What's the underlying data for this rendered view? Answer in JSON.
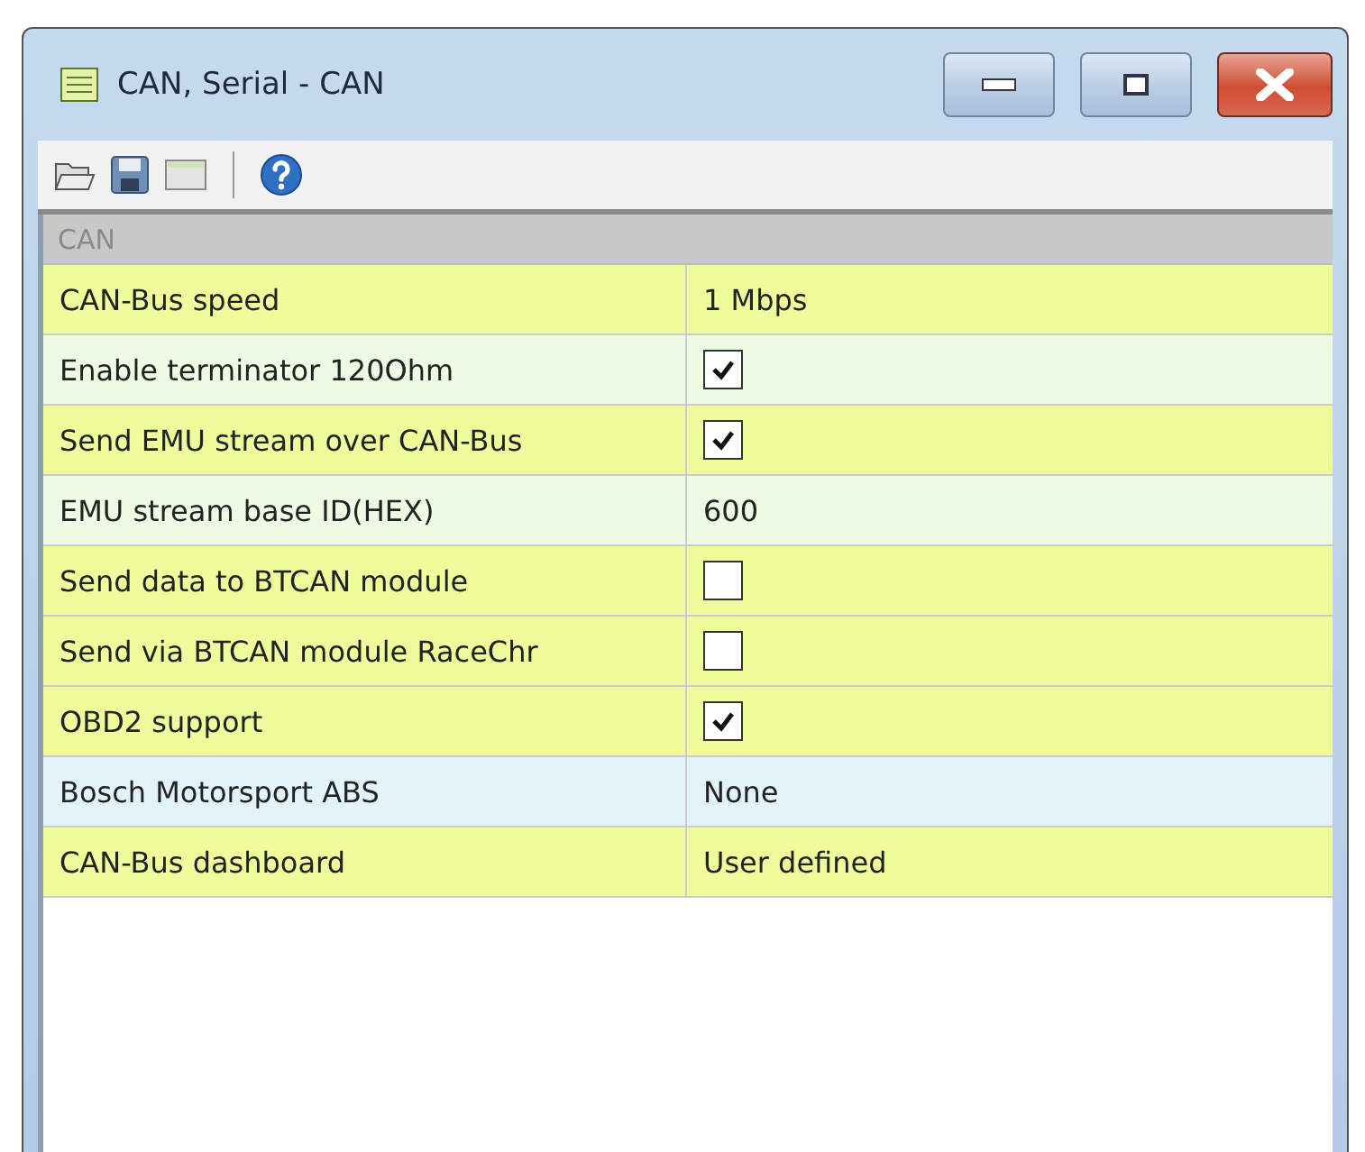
{
  "window": {
    "title": "CAN, Serial - CAN"
  },
  "group": {
    "label": "CAN"
  },
  "rows": [
    {
      "label": "CAN-Bus speed",
      "kind": "text",
      "value": "1 Mbps",
      "color": "#eefc9c"
    },
    {
      "label": "Enable terminator 120Ohm",
      "kind": "checkbox",
      "checked": true,
      "color": "#eefbe4"
    },
    {
      "label": "Send EMU stream over CAN-Bus",
      "kind": "checkbox",
      "checked": true,
      "color": "#eefc9c"
    },
    {
      "label": "EMU stream base ID(HEX)",
      "kind": "text",
      "value": "600",
      "color": "#eefbe4"
    },
    {
      "label": "Send data to BTCAN module",
      "kind": "checkbox",
      "checked": false,
      "color": "#eefc9c"
    },
    {
      "label": "Send via BTCAN module RaceChr",
      "kind": "checkbox",
      "checked": false,
      "color": "#eefc9c"
    },
    {
      "label": "OBD2 support",
      "kind": "checkbox",
      "checked": true,
      "color": "#eefc9c"
    },
    {
      "label": "Bosch Motorsport ABS",
      "kind": "text",
      "value": "None",
      "color": "#e2f3fa"
    },
    {
      "label": "CAN-Bus dashboard",
      "kind": "text",
      "value": "User defined",
      "color": "#eefc9c"
    }
  ]
}
